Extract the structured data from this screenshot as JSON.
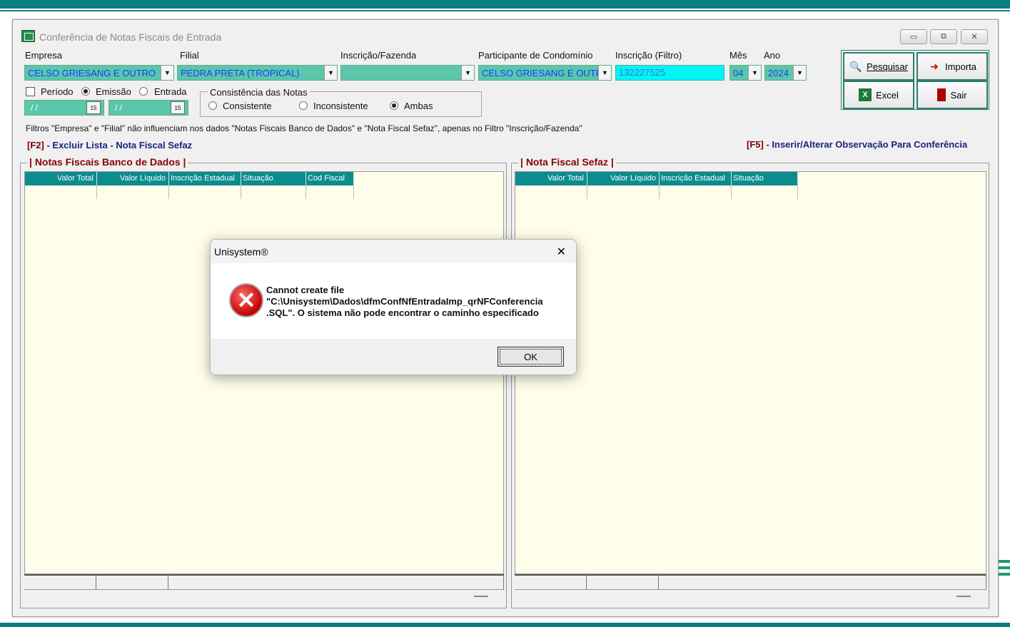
{
  "window": {
    "title": "Conferência de Notas Fiscais de Entrada",
    "minimize_label": "▭",
    "restore_label": "⧉",
    "close_label": "✕"
  },
  "filters": {
    "empresa_label": "Empresa",
    "empresa_value": "CELSO GRIESANG E OUTRO",
    "filial_label": "Filial",
    "filial_value": "PEDRA PRETA (TROPICAL)",
    "inscricao_fazenda_label": "Inscrição/Fazenda",
    "inscricao_fazenda_value": "",
    "participante_label": "Participante de Condomínio",
    "participante_value": "CELSO GRIESANG E OUTR",
    "inscricao_filtro_label": "Inscrição (Filtro)",
    "inscricao_filtro_value": "132227525",
    "mes_label": "Mês",
    "mes_value": "04",
    "ano_label": "Ano",
    "ano_value": "2024",
    "periodo_label": "Período",
    "emissao_label": "Emissão",
    "entrada_label": "Entrada",
    "date_from": "/ /",
    "date_to": "/ /",
    "cal_icon": "15",
    "consistencia_label": "Consistência das Notas",
    "consistente_label": "Consistente",
    "inconsistente_label": "Inconsistente",
    "ambas_label": "Ambas"
  },
  "toolbar": {
    "pesquisar_label": "Pesquisar",
    "importa_label": "Importa",
    "excel_label": "Excel",
    "sair_label": "Sair"
  },
  "info": {
    "note": "Filtros \"Empresa\" e \"Filial\" não influenciam nos dados \"Notas Fiscais Banco de Dados\" e \"Nota Fiscal Sefaz\", apenas no Filtro \"Inscrição/Fazenda\"",
    "f2_key": "[F2]",
    "f2_text": " - Excluir Lista - Nota Fiscal Sefaz",
    "f5_key": "[F5]",
    "f5_text": " - Inserir/Alterar Observação Para Conferência"
  },
  "left_panel": {
    "title": "Notas Fiscais Banco de Dados",
    "columns": [
      "Valor Total",
      "Valor Líquido",
      "Inscrição Estadual",
      "Situação",
      "Cod Fiscal"
    ]
  },
  "right_panel": {
    "title": "Nota Fiscal Sefaz",
    "columns": [
      "Valor Total",
      "Valor Líquido",
      "Inscrição Estadual",
      "Situação"
    ]
  },
  "dialog": {
    "title": "Unisystem®",
    "message": "Cannot create file\n\"C:\\Unisystem\\Dados\\dfmConfNfEntradaImp_qrNFConferencia\n.SQL\". O sistema não pode encontrar o caminho especificado",
    "ok_label": "OK",
    "close_label": "✕"
  }
}
